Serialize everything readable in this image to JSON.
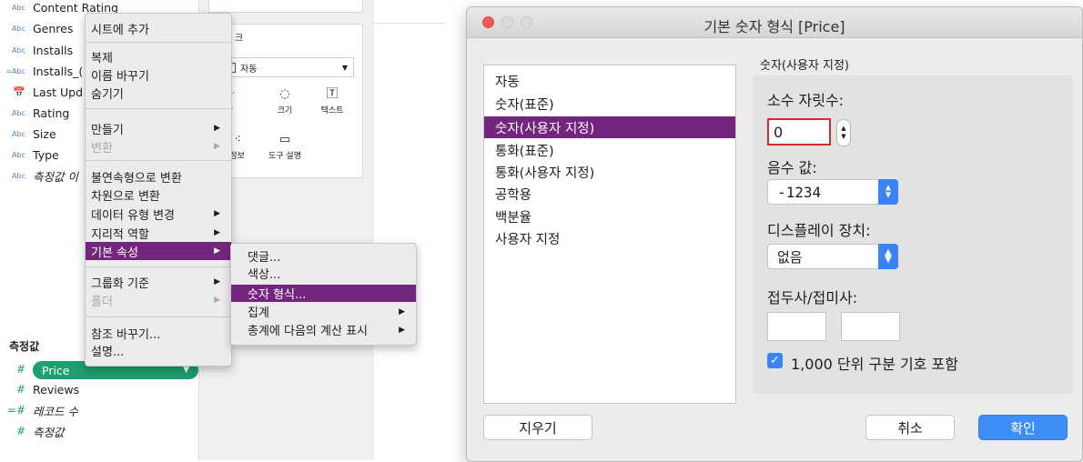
{
  "fields": [
    {
      "type": "Abc",
      "name": "Content Rating"
    },
    {
      "type": "Abc",
      "name": "Genres"
    },
    {
      "type": "Abc",
      "name": "Installs"
    },
    {
      "type": "=Abc",
      "name": "Installs_("
    },
    {
      "type": "📅",
      "name": "Last Upd"
    },
    {
      "type": "Abc",
      "name": "Rating"
    },
    {
      "type": "Abc",
      "name": "Size"
    },
    {
      "type": "Abc",
      "name": "Type"
    },
    {
      "type": "Abc",
      "name": "측정값 이"
    }
  ],
  "measures": {
    "header": "측정값",
    "items": [
      {
        "type": "#",
        "name": "Price"
      },
      {
        "type": "#",
        "name": "Reviews"
      },
      {
        "type": "=#",
        "name": "레코드 수"
      },
      {
        "type": "#",
        "name": "측정값"
      }
    ]
  },
  "marks": {
    "type_label": "자동",
    "section_letter": "크",
    "buttons": [
      {
        "label": "색상"
      },
      {
        "label": "크기"
      },
      {
        "label": "텍스트"
      },
      {
        "label": "세부 정보"
      },
      {
        "label": "도구 설명"
      }
    ]
  },
  "context_menu": {
    "items": [
      {
        "label": "시트에 추가"
      },
      {
        "label": "복제"
      },
      {
        "label": "이름 바꾸기"
      },
      {
        "label": "숨기기"
      },
      {
        "label": "만들기"
      },
      {
        "label": "변환"
      },
      {
        "label": "불연속형으로 변환"
      },
      {
        "label": "차원으로 변환"
      },
      {
        "label": "데이터 유형 변경"
      },
      {
        "label": "지리적 역할"
      },
      {
        "label": "기본 속성"
      },
      {
        "label": "그룹화 기준"
      },
      {
        "label": "폴더"
      },
      {
        "label": "참조 바꾸기..."
      },
      {
        "label": "설명..."
      }
    ]
  },
  "sub_menu": {
    "items": [
      {
        "label": "댓글..."
      },
      {
        "label": "색상..."
      },
      {
        "label": "숫자 형식..."
      },
      {
        "label": "집계"
      },
      {
        "label": "총계에 다음의 계산 표시"
      }
    ]
  },
  "dialog": {
    "title": "기본 숫자 형식 [Price]",
    "formats": [
      "자동",
      "숫자(표준)",
      "숫자(사용자 지정)",
      "통화(표준)",
      "통화(사용자 지정)",
      "공학용",
      "백분율",
      "사용자 지정"
    ],
    "selected_format": "숫자(사용자 지정)",
    "panel_title": "숫자(사용자 지정)",
    "decimals_label": "소수 자릿수:",
    "decimals_value": "0",
    "negative_label": "음수 값:",
    "negative_value": "-1234",
    "display_unit_label": "디스플레이 장치:",
    "display_unit_value": "없음",
    "prefix_suffix_label": "접두사/접미사:",
    "prefix_value": "",
    "suffix_value": "",
    "thousands_label": "1,000 단위 구분 기호 포함",
    "thousands_checked": true,
    "clear_button": "지우기",
    "cancel_button": "취소",
    "ok_button": "확인"
  },
  "colors": {
    "highlight": "#74267e",
    "pill": "#1f9e6e",
    "accent": "#3f8df7"
  }
}
